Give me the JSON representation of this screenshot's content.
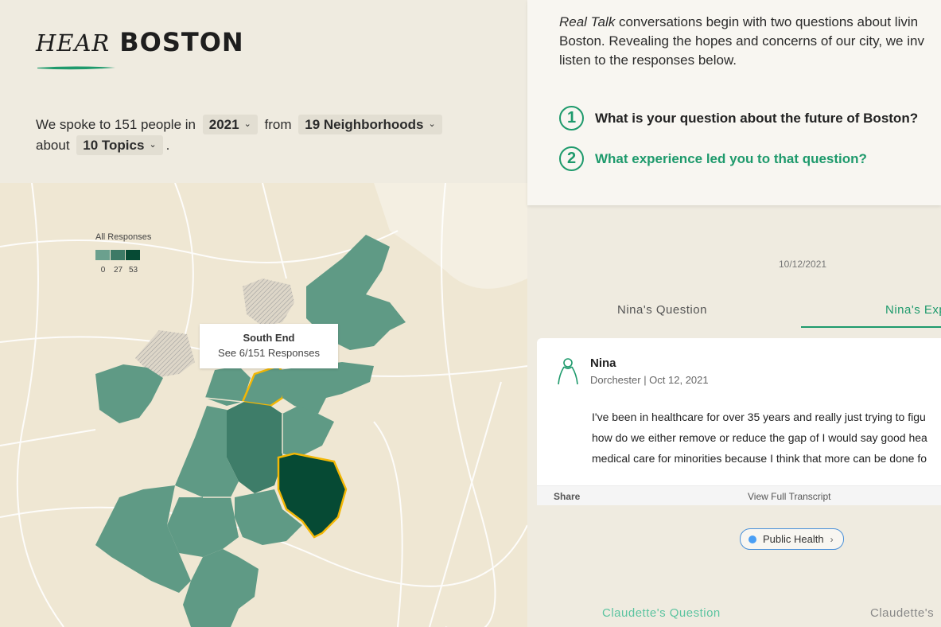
{
  "header": {
    "logo_hear": "HEAR",
    "logo_boston": "BOSTON"
  },
  "intro": {
    "prefix": "We spoke to 151 people in",
    "year": "2021",
    "from": "from",
    "neighborhoods": "19 Neighborhoods",
    "about": "about",
    "topics": "10 Topics",
    "end": "."
  },
  "map": {
    "legend_title": "All Responses",
    "legend_values": [
      "0",
      "27",
      "53"
    ],
    "legend_colors": [
      "#6ba08e",
      "#3d7a66",
      "#064a34"
    ],
    "tooltip_title": "South End",
    "tooltip_text": "See 6/151 Responses"
  },
  "right": {
    "intro_em": "Real Talk",
    "intro_line1": " conversations begin with two questions about livin",
    "intro_line2": "Boston. Revealing the hopes and concerns of our city, we inv",
    "intro_line3": "listen to the responses below.",
    "q1_num": "1",
    "q1_text": "What is your question about the future of Boston?",
    "q2_num": "2",
    "q2_text": "What experience led you to that question?",
    "date": "10/12/2021",
    "tab1": "Nina's Question",
    "tab2": "Nina's Exp",
    "card": {
      "name": "Nina",
      "meta": "Dorchester | Oct 12, 2021",
      "line1": "I've been in healthcare for over 35 years and really just trying to figu",
      "line2": "how do we either remove or reduce the gap of I would say good hea",
      "line3": "medical care for minorities because I think that more can be done fo",
      "share": "Share",
      "view_transcript": "View Full Transcript"
    },
    "tag": "Public Health",
    "next_tab1": "Claudette's Question",
    "next_tab2": "Claudette's"
  },
  "colors": {
    "accent": "#1e9a6c",
    "highlight": "#f2b705",
    "background": "#efebe0"
  }
}
